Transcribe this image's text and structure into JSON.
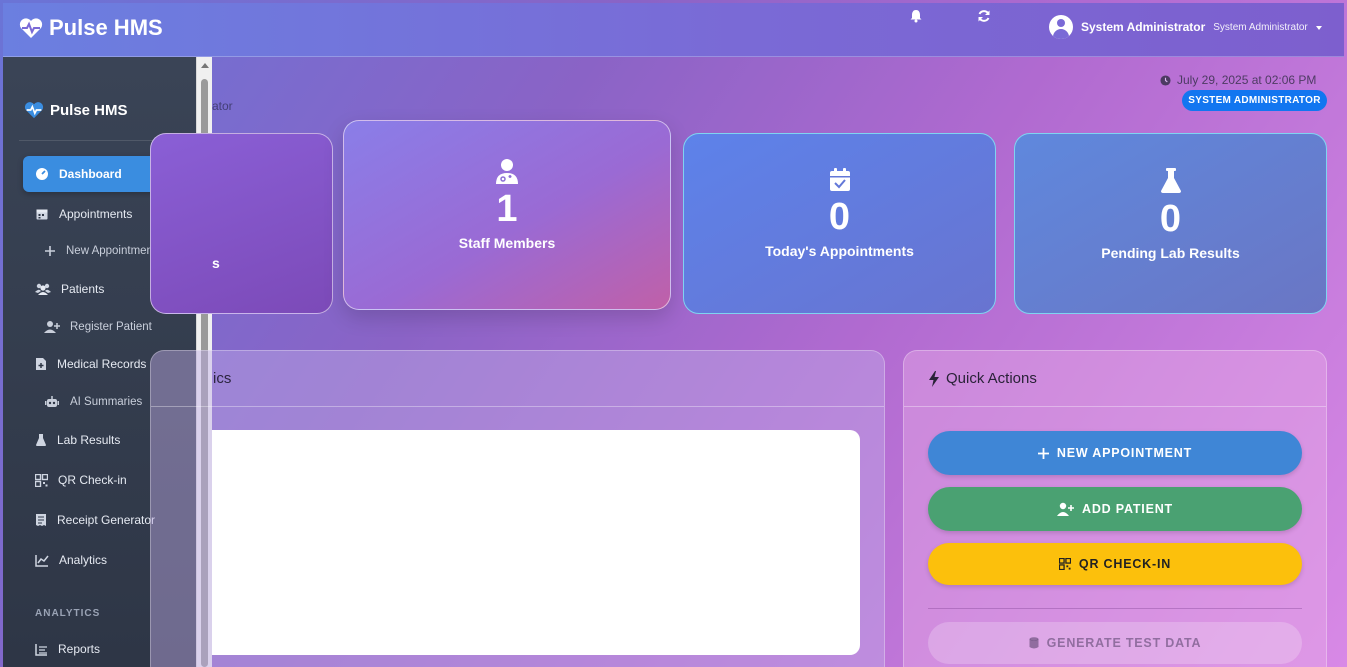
{
  "app": {
    "brand": "Pulse HMS"
  },
  "navbar": {
    "user_name": "System Administrator",
    "user_role": "System Administrator"
  },
  "sidebar": {
    "brand": "Pulse HMS",
    "items": [
      {
        "label": "Dashboard",
        "icon": "gauge-icon",
        "active": true
      },
      {
        "label": "Appointments",
        "icon": "calendar-icon"
      },
      {
        "label": "New Appointment",
        "icon": "plus-icon",
        "sub": true
      },
      {
        "label": "Patients",
        "icon": "users-icon"
      },
      {
        "label": "Register Patient",
        "icon": "user-plus-icon",
        "sub": true
      },
      {
        "label": "Medical Records",
        "icon": "file-medical-icon"
      },
      {
        "label": "AI Summaries",
        "icon": "robot-icon",
        "sub": true
      },
      {
        "label": "Lab Results",
        "icon": "flask-icon"
      },
      {
        "label": "QR Check-in",
        "icon": "qrcode-icon"
      },
      {
        "label": "Receipt Generator",
        "icon": "receipt-icon"
      },
      {
        "label": "Analytics",
        "icon": "chart-line-icon"
      }
    ],
    "section_heading": "ANALYTICS",
    "section_items": [
      {
        "label": "Reports",
        "icon": "list-icon"
      }
    ]
  },
  "header": {
    "subtitle_partial": "ator",
    "datetime": "July 29, 2025 at 02:06 PM",
    "role_badge": "SYSTEM ADMINISTRATOR"
  },
  "stats": [
    {
      "value": "",
      "label_partial": "s"
    },
    {
      "value": "1",
      "label": "Staff Members",
      "icon": "user-doctor-icon"
    },
    {
      "value": "0",
      "label": "Today's Appointments",
      "icon": "calendar-check-icon"
    },
    {
      "value": "0",
      "label": "Pending Lab Results",
      "icon": "flask-icon"
    }
  ],
  "analytics_panel": {
    "title_partial": "ics"
  },
  "quick_actions": {
    "title": "Quick Actions",
    "buttons": {
      "new_appointment": "NEW APPOINTMENT",
      "add_patient": "ADD PATIENT",
      "qr_checkin": "QR CHECK-IN",
      "generate_test_data": "GENERATE TEST DATA"
    }
  },
  "colors": {
    "active_blue": "#3a8de0",
    "badge_blue": "#1276f0",
    "success_green": "#4aa172",
    "warning_yellow": "#fcc00c"
  }
}
